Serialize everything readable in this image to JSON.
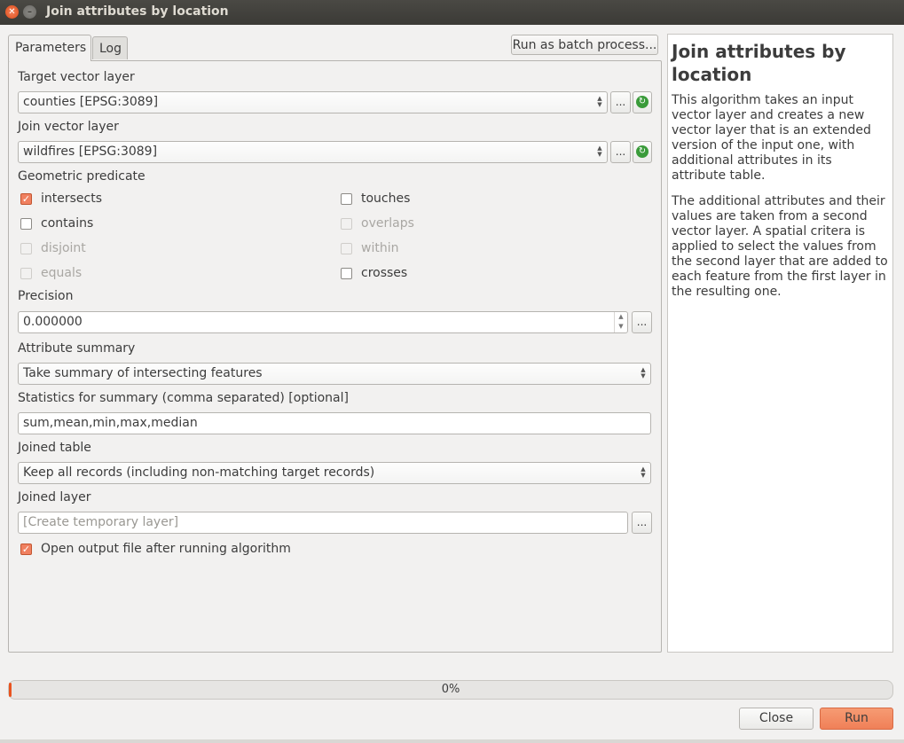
{
  "window": {
    "title": "Join attributes by location"
  },
  "tabs": [
    {
      "label": "Parameters"
    },
    {
      "label": "Log"
    }
  ],
  "toolbar": {
    "batch_label": "Run as batch process..."
  },
  "params": {
    "target_layer": {
      "label": "Target vector layer",
      "value": "counties [EPSG:3089]"
    },
    "join_layer": {
      "label": "Join vector layer",
      "value": "wildfires [EPSG:3089]"
    },
    "predicate": {
      "label": "Geometric predicate",
      "options": [
        {
          "label": "intersects",
          "checked": true,
          "enabled": true
        },
        {
          "label": "touches",
          "checked": false,
          "enabled": true
        },
        {
          "label": "contains",
          "checked": false,
          "enabled": true
        },
        {
          "label": "overlaps",
          "checked": false,
          "enabled": false
        },
        {
          "label": "disjoint",
          "checked": false,
          "enabled": false
        },
        {
          "label": "within",
          "checked": false,
          "enabled": false
        },
        {
          "label": "equals",
          "checked": false,
          "enabled": false
        },
        {
          "label": "crosses",
          "checked": false,
          "enabled": true
        }
      ]
    },
    "precision": {
      "label": "Precision",
      "value": "0.000000"
    },
    "summary": {
      "label": "Attribute summary",
      "value": "Take summary of intersecting features"
    },
    "statistics": {
      "label": "Statistics for summary (comma separated) [optional]",
      "value": "sum,mean,min,max,median"
    },
    "joined_table": {
      "label": "Joined table",
      "value": "Keep all records (including non-matching target records)"
    },
    "joined_layer": {
      "label": "Joined layer",
      "placeholder": "[Create temporary layer]"
    },
    "open_output": {
      "label": "Open output file after running algorithm",
      "checked": true
    }
  },
  "help": {
    "title": "Join attributes by location",
    "paragraphs": [
      "This algorithm takes an input vector layer and creates a new vector layer that is an extended version of the input one, with additional attributes in its attribute table.",
      "The additional attributes and their values are taken from a second vector layer. A spatial critera is applied to select the values from the second layer that are added to each feature from the first layer in the resulting one."
    ]
  },
  "progress": {
    "text": "0%",
    "value": 0
  },
  "buttons": {
    "close": "Close",
    "run": "Run"
  },
  "glyphs": {
    "ellipsis": "...",
    "check": "✓",
    "iterate": "↻",
    "up": "▲",
    "down": "▼",
    "close_x": "✕",
    "minimize": "–"
  },
  "colors": {
    "accent": "#e95420",
    "check_on": "#f08060",
    "iterate_green": "#3a9b3a"
  }
}
